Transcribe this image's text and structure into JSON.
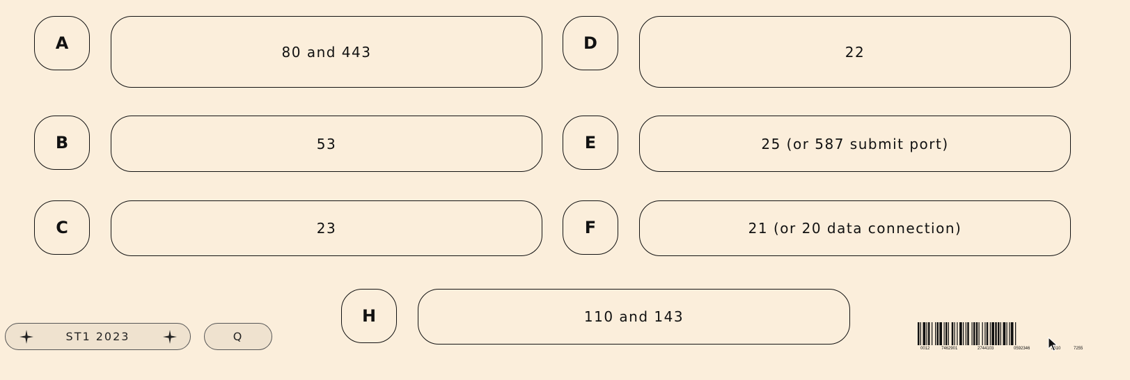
{
  "choices": [
    {
      "letter": "A",
      "answer": "80 and 443"
    },
    {
      "letter": "B",
      "answer": "53"
    },
    {
      "letter": "C",
      "answer": "23"
    },
    {
      "letter": "D",
      "answer": "22"
    },
    {
      "letter": "E",
      "answer": "25 (or 587 submit port)"
    },
    {
      "letter": "F",
      "answer": "21 (or 20 data connection)"
    },
    {
      "letter": "H",
      "answer": "110 and 143"
    }
  ],
  "footer": {
    "brand_label": "ST1 2023",
    "q_label": "Q"
  },
  "barcode": {
    "digits": [
      "0012",
      "7462901",
      "2744103",
      "0592346",
      "8510",
      "7255"
    ]
  },
  "colors": {
    "background": "#fbeedb",
    "border": "#111111"
  },
  "icons": {
    "sparkle": "sparkle-icon",
    "cursor": "mouse-pointer-icon"
  }
}
